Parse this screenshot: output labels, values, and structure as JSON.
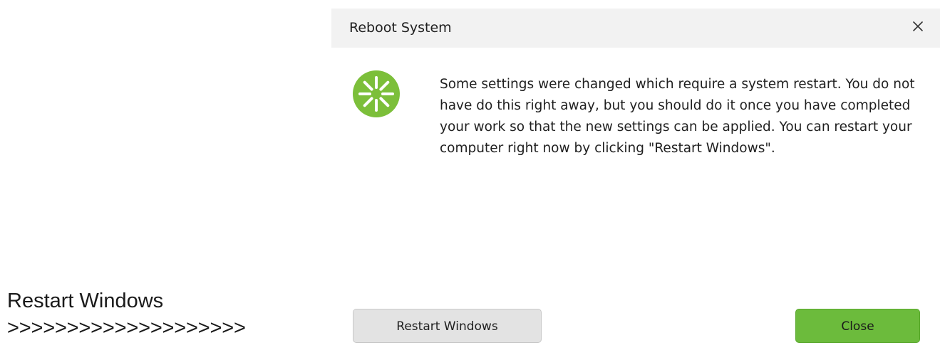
{
  "annotation": {
    "title": "Restart Windows",
    "arrows": ">>>>>>>>>>>>>>>>>>>>"
  },
  "dialog": {
    "title": "Reboot System",
    "close_icon": "close-icon",
    "status_icon": "spinner-icon",
    "accent_color": "#7cbf3a",
    "message": "Some settings were changed which require a system restart. You do not have do this right away, but you should do it once you have completed your work so that the new settings can be applied. You can restart your computer right now by clicking \"Restart Windows\".",
    "buttons": {
      "restart_label": "Restart Windows",
      "close_label": "Close"
    }
  }
}
